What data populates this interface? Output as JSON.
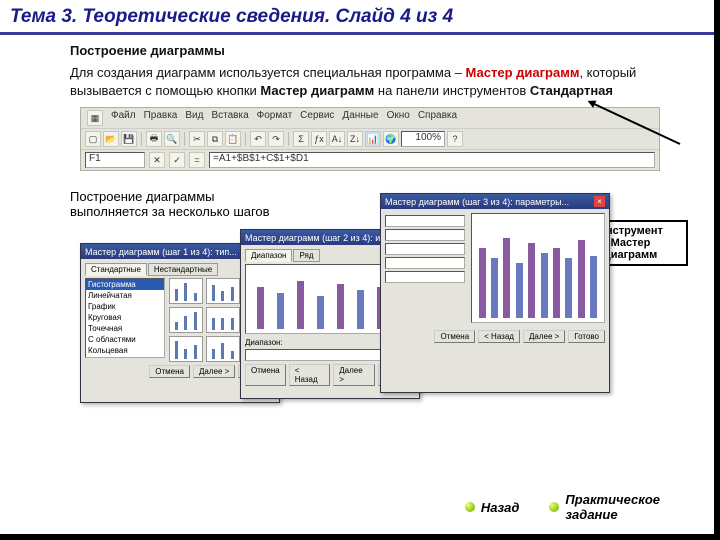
{
  "title": "Тема 3. Теоретические сведения. Слайд 4 из 4",
  "subhead": "Построение диаграммы",
  "para_1a": "Для создания диаграмм  используется специальная программа – ",
  "para_1b": "Мастер диаграмм",
  "para_1c": ", который вызывается с помощью кнопки ",
  "para_1d": "Мастер диаграмм",
  "para_1e": "  на панели инструментов ",
  "para_1f": "Стандартная",
  "menu": {
    "file": "Файл",
    "edit": "Правка",
    "view": "Вид",
    "insert": "Вставка",
    "format": "Формат",
    "tools": "Сервис",
    "data": "Данные",
    "window": "Окно",
    "help": "Справка"
  },
  "cellref": "F1",
  "formula": "=A1+$B$1+C$1+$D1",
  "zoom": "100%",
  "callout_l1": "Инструмент",
  "callout_l2": "Мастер",
  "callout_l3": "диаграмм",
  "steps_l1": "Построение диаграммы",
  "steps_l2": "выполняется за несколько шагов",
  "wiz1_title": "Мастер диаграмм (шаг 1 из 4): тип...",
  "wiz2_title": "Мастер диаграмм (шаг 2 из 4): ист...",
  "wiz3_title": "Мастер диаграмм (шаг 3 из 4): параметры...",
  "tab_std": "Стандартные",
  "tab_custom": "Нестандартные",
  "list_items": [
    "Гистограмма",
    "Линейчатая",
    "График",
    "Круговая",
    "Точечная",
    "С областями",
    "Кольцевая"
  ],
  "tab_range": "Диапазон",
  "tab_series": "Ряд",
  "range_label": "Диапазон:",
  "btn_cancel": "Отмена",
  "btn_back": "< Назад",
  "btn_next": "Далее >",
  "btn_finish": "Готово",
  "nav_back": "Назад",
  "nav_task_l1": "Практическое",
  "nav_task_l2": "задание"
}
